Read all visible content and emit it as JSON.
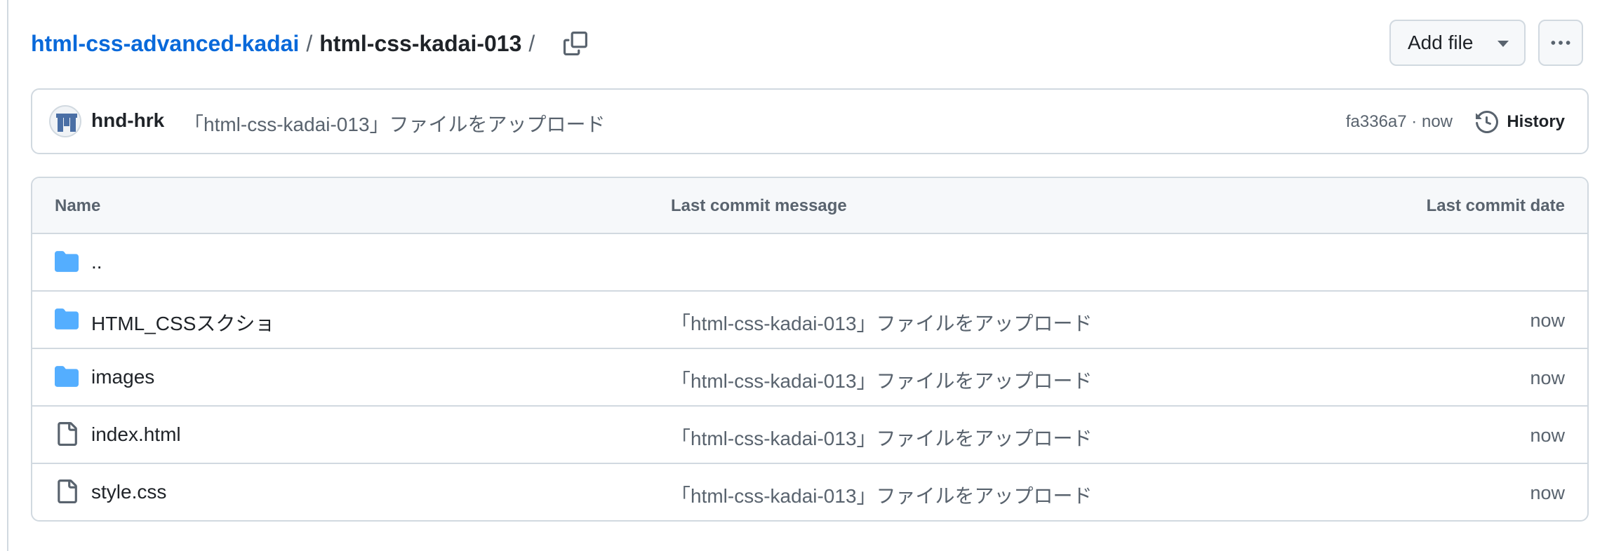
{
  "breadcrumb": {
    "repo": "html-css-advanced-kadai",
    "separator": "/",
    "current": "html-css-kadai-013",
    "trailing": "/"
  },
  "actions": {
    "add_file_label": "Add file",
    "copy_icon": "copy-icon",
    "more_icon": "kebab-horizontal-icon"
  },
  "commit": {
    "author": "hnd-hrk",
    "message": "「html-css-kadai-013」ファイルをアップロード",
    "sha": "fa336a7",
    "separator": "·",
    "time": "now",
    "history_label": "History"
  },
  "table": {
    "columns": [
      "Name",
      "Last commit message",
      "Last commit date"
    ],
    "parent_row": {
      "name": "..",
      "icon": "folder-icon"
    },
    "rows": [
      {
        "name": "HTML_CSSスクショ",
        "type": "folder",
        "icon": "folder-icon",
        "message": "「html-css-kadai-013」ファイルをアップロード",
        "date": "now"
      },
      {
        "name": "images",
        "type": "folder",
        "icon": "folder-icon",
        "message": "「html-css-kadai-013」ファイルをアップロード",
        "date": "now"
      },
      {
        "name": "index.html",
        "type": "file",
        "icon": "file-icon",
        "message": "「html-css-kadai-013」ファイルをアップロード",
        "date": "now"
      },
      {
        "name": "style.css",
        "type": "file",
        "icon": "file-icon",
        "message": "「html-css-kadai-013」ファイルをアップロード",
        "date": "now"
      }
    ]
  },
  "colors": {
    "link": "#0969da",
    "folder": "#54aeff",
    "border": "#d1d9e0",
    "muted": "#59636e",
    "header_bg": "#f6f8fa"
  }
}
